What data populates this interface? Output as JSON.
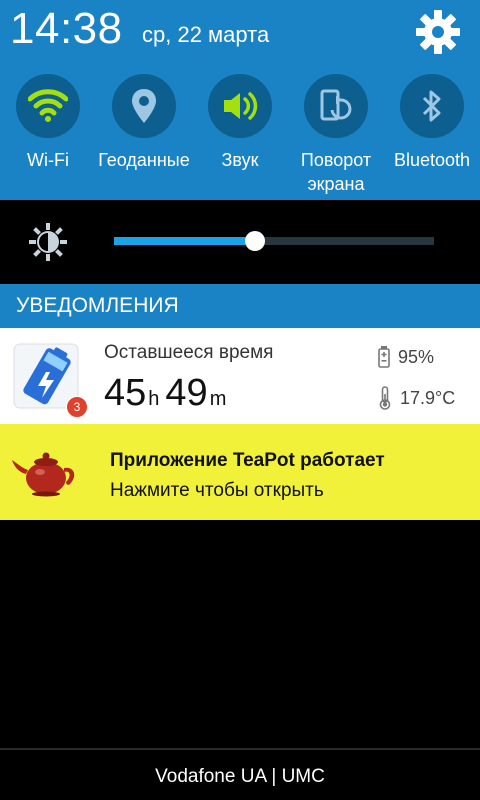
{
  "status": {
    "time": "14:38",
    "date": "ср, 22 марта"
  },
  "quick_settings": [
    {
      "label": "Wi-Fi",
      "icon": "wifi-icon",
      "active": true
    },
    {
      "label": "Геоданные",
      "icon": "location-icon",
      "active": false
    },
    {
      "label": "Звук",
      "icon": "sound-icon",
      "active": true
    },
    {
      "label_line1": "Поворот",
      "label_line2": "экрана",
      "icon": "rotate-icon",
      "active": false
    },
    {
      "label": "Bluetooth",
      "icon": "bluetooth-icon",
      "active": false
    }
  ],
  "brightness": {
    "level": 0.44
  },
  "notifications_header": "УВЕДОМЛЕНИЯ",
  "battery_notification": {
    "label": "Оставшееся время",
    "hours": "45",
    "hours_unit": "h",
    "minutes": "49",
    "minutes_unit": "m",
    "battery_percent": "95%",
    "temperature": "17.9°C",
    "badge_count": "3"
  },
  "teapot_notification": {
    "title": "Приложение TeaPot работает",
    "subtitle": "Нажмите чтобы открыть"
  },
  "carrier": "Vodafone UA | UMC",
  "colors": {
    "header_bg": "#1a83c6",
    "toggle_circle": "#0c5f8f",
    "active_icon": "#a4e00e",
    "inactive_icon": "#9ec7e4",
    "teapot_bg": "#f1f13a",
    "slider_fill": "#1aa3e8"
  }
}
